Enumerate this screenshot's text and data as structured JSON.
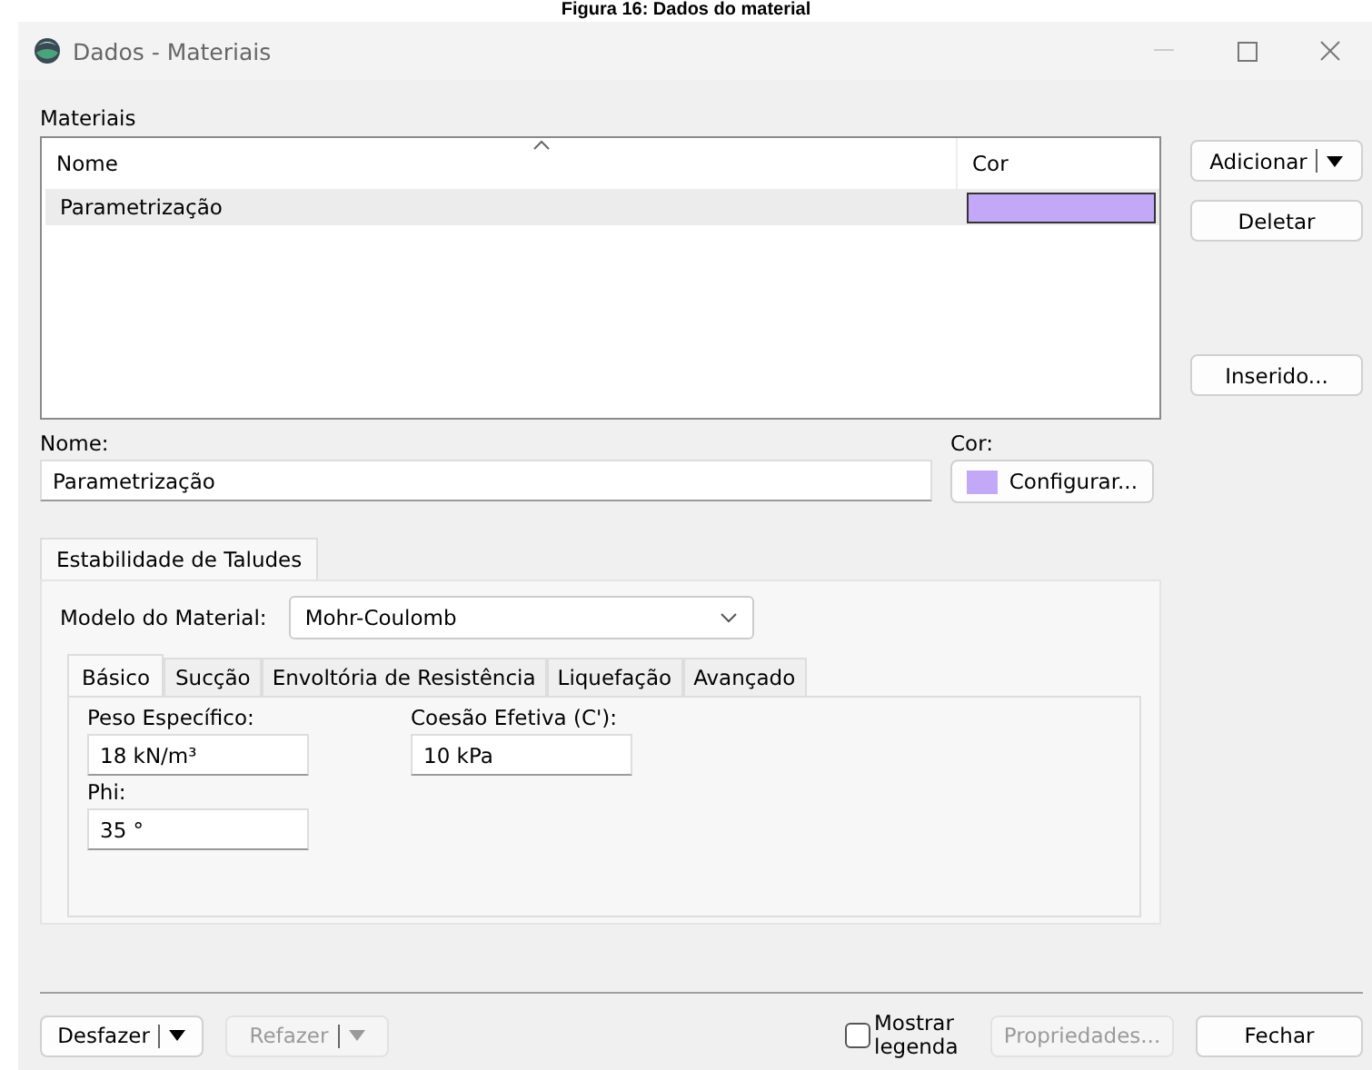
{
  "caption": "Figura 16: Dados do material",
  "window": {
    "title": "Dados - Materiais"
  },
  "materials": {
    "label": "Materiais",
    "columns": [
      "Nome",
      "Cor"
    ],
    "rows": [
      {
        "name": "Parametrização",
        "color": "#c4a8f8",
        "selected": true
      }
    ]
  },
  "side_buttons": [
    "Adicionar",
    "Deletar",
    "Inserido..."
  ],
  "name_field": {
    "label": "Nome:",
    "value": "Parametrização"
  },
  "color_field": {
    "label": "Cor:",
    "color": "#c4a8f8",
    "button": "Configurar..."
  },
  "group_tabs": [
    {
      "label": "Estabilidade de Taludes",
      "selected": true
    }
  ],
  "model": {
    "label": "Modelo do Material:",
    "value": "Mohr-Coulomb"
  },
  "tabs": [
    {
      "label": "Básico",
      "selected": true
    },
    {
      "label": "Sucção",
      "selected": false
    },
    {
      "label": "Envoltória de Resistência",
      "selected": false
    },
    {
      "label": "Liquefação",
      "selected": false
    },
    {
      "label": "Avançado",
      "selected": false
    }
  ],
  "fields": [
    {
      "label": "Peso Específico:",
      "value": "18 kN/m³"
    },
    {
      "label": "Coesão Efetiva (C'):",
      "value": "10 kPa"
    },
    {
      "label": "Phi:",
      "value": "35 °"
    }
  ],
  "footer": {
    "undo": {
      "label": "Desfazer",
      "disabled": false
    },
    "redo": {
      "label": "Refazer",
      "disabled": true
    },
    "legend": {
      "label": "Mostrar legenda",
      "checked": false
    },
    "properties": {
      "label": "Propriedades...",
      "disabled": true
    },
    "close": {
      "label": "Fechar",
      "disabled": false
    }
  }
}
